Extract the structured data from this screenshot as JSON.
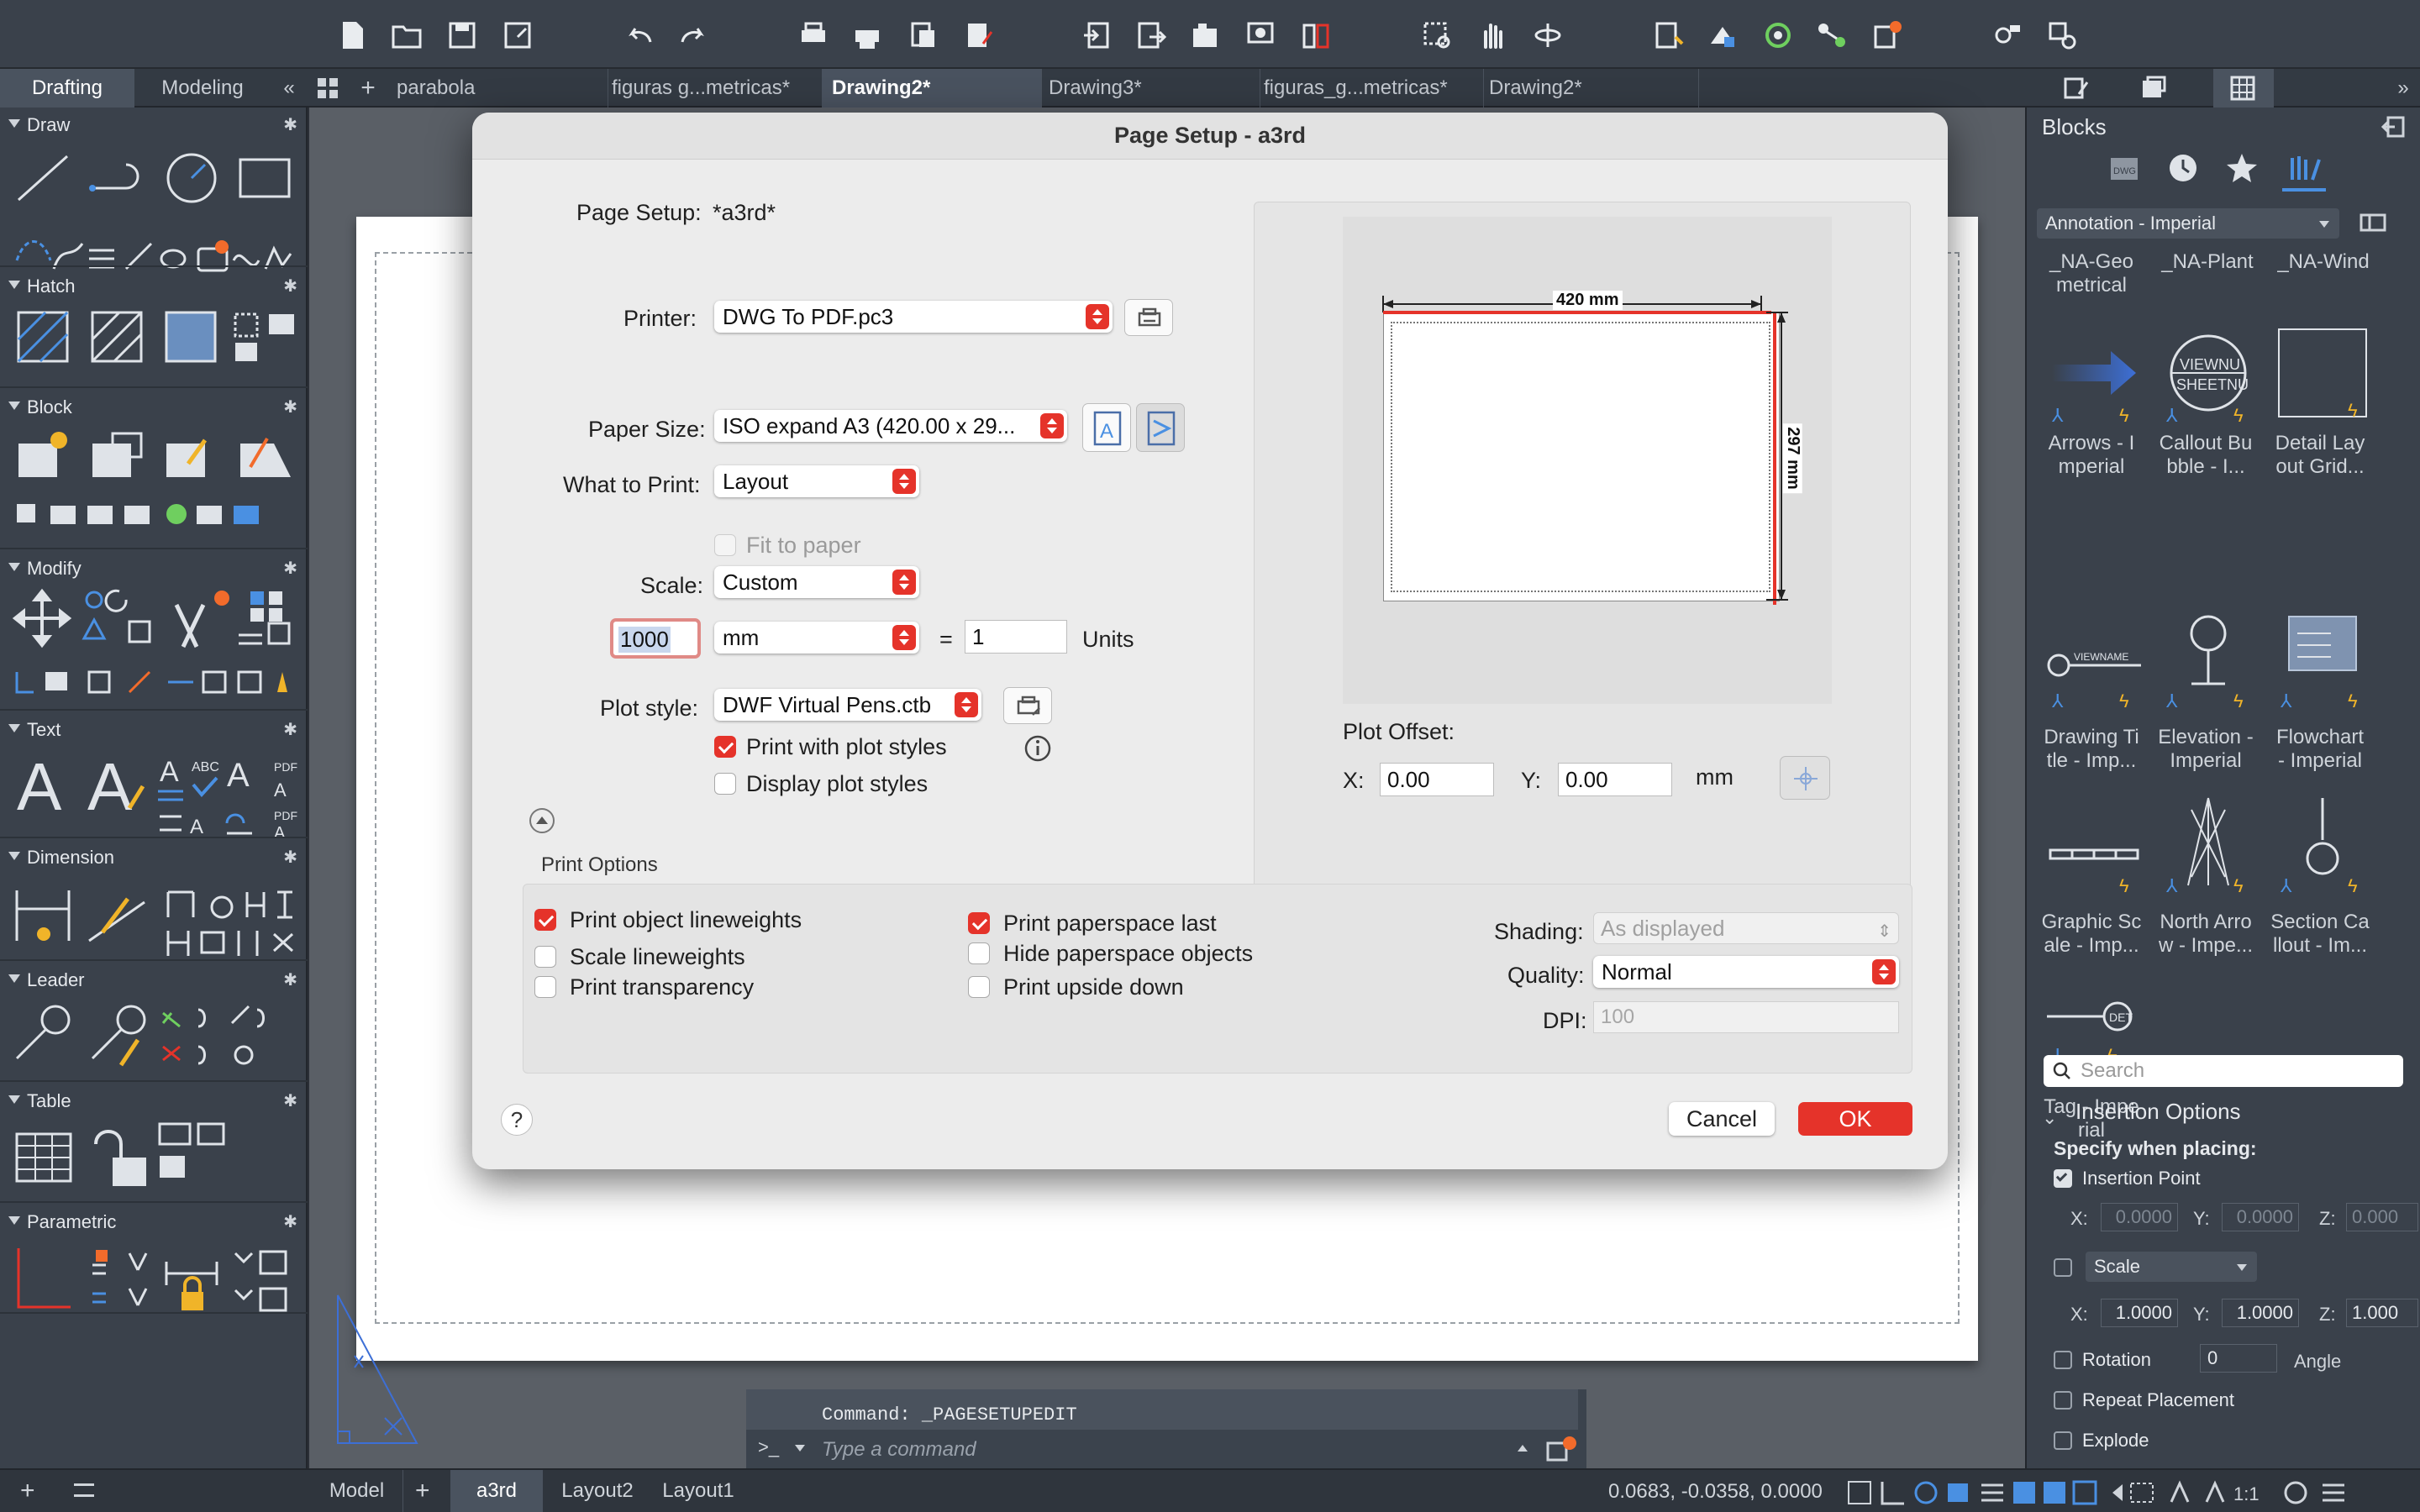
{
  "tabs_bar": {
    "panel_tabs": [
      "Drafting",
      "Modeling"
    ],
    "doc_tabs": [
      "parabola",
      "figuras g...metricas*",
      "Drawing2*",
      "Drawing3*",
      "figuras_g...metricas*",
      "Drawing2*"
    ],
    "collapse": "«",
    "add": "+"
  },
  "left_palette": {
    "sections": [
      "Draw",
      "Hatch",
      "Block",
      "Modify",
      "Text",
      "Dimension",
      "Leader",
      "Table",
      "Parametric"
    ]
  },
  "right_palette": {
    "title": "Blocks",
    "library": "Annotation - Imperial",
    "top_names": [
      "_NA-Geo\nmetrical",
      "_NA-Plant",
      "_NA-Wind"
    ],
    "blocks": [
      "Arrows - I\nmperial",
      "Callout Bu\nbble - I...",
      "Detail Lay\nout Grid...",
      "Drawing Ti\ntle - Imp...",
      "Elevation -\nImperial",
      "Flowchart\n- Imperial",
      "Graphic Sc\nale - Imp...",
      "North Arro\nw - Impe...",
      "Section Ca\nllout - Im...",
      "Tag - Impe\nrial"
    ],
    "search_placeholder": "Search",
    "insertion_title": "Insertion Options",
    "specify_label": "Specify when placing:",
    "insertion_point": "Insertion Point",
    "ip_x": "0.0000",
    "ip_y": "0.0000",
    "ip_z": "0.000",
    "scale_label": "Scale",
    "sc_x": "1.0000",
    "sc_y": "1.0000",
    "sc_z": "1.000",
    "rotation_label": "Rotation",
    "rotation_value": "0",
    "angle_label": "Angle",
    "repeat_label": "Repeat Placement",
    "explode_label": "Explode",
    "x_lbl": "X:",
    "y_lbl": "Y:",
    "z_lbl": "Z:"
  },
  "dialog": {
    "title": "Page Setup - a3rd",
    "page_setup_label": "Page Setup:",
    "page_setup_value": "*a3rd*",
    "printer_label": "Printer:",
    "printer_value": "DWG To PDF.pc3",
    "paper_size_label": "Paper Size:",
    "paper_size_value": "ISO expand A3 (420.00 x 29...",
    "what_to_print_label": "What to Print:",
    "what_to_print_value": "Layout",
    "fit_to_paper": "Fit to paper",
    "scale_label": "Scale:",
    "scale_value": "Custom",
    "scale_number": "1000",
    "scale_unit": "mm",
    "equals": "=",
    "scale_units_value": "1",
    "units_label": "Units",
    "plot_style_label": "Plot style:",
    "plot_style_value": "DWF Virtual Pens.ctb",
    "print_with_plot_styles": "Print with plot styles",
    "display_plot_styles": "Display plot styles",
    "preview_width": "420 mm",
    "preview_height": "297 mm",
    "plot_offset_label": "Plot Offset:",
    "offset_x_label": "X:",
    "offset_x": "0.00",
    "offset_y_label": "Y:",
    "offset_y": "0.00",
    "offset_unit": "mm",
    "print_options_title": "Print Options",
    "print_object_lineweights": "Print object lineweights",
    "scale_lineweights": "Scale lineweights",
    "print_transparency": "Print transparency",
    "print_paperspace_last": "Print paperspace last",
    "hide_paperspace_objects": "Hide paperspace objects",
    "print_upside_down": "Print upside down",
    "shading_label": "Shading:",
    "shading_value": "As displayed",
    "quality_label": "Quality:",
    "quality_value": "Normal",
    "dpi_label": "DPI:",
    "dpi_value": "100",
    "help": "?",
    "cancel": "Cancel",
    "ok": "OK"
  },
  "command": {
    "history": "Command: _PAGESETUPEDIT",
    "prompt": ">_",
    "placeholder": "Type a command"
  },
  "status": {
    "layout_tabs": [
      "Model",
      "a3rd",
      "Layout2",
      "Layout1"
    ],
    "add": "+",
    "coords": "0.0683, -0.0358, 0.0000"
  },
  "colors": {
    "accent": "#e5332a",
    "toolbar": "#3a414b",
    "dialog": "#ececec",
    "blue": "#4a90e2"
  }
}
